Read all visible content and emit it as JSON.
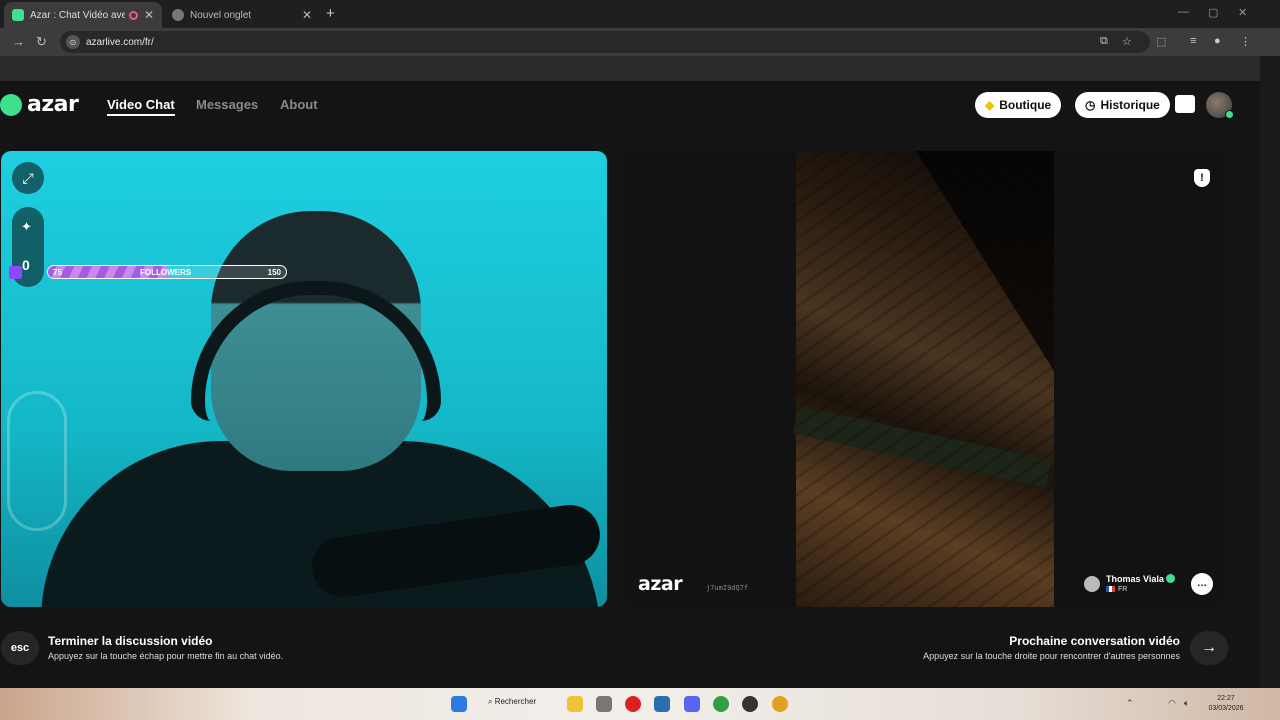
{
  "browser": {
    "tabs": [
      {
        "title": "Azar : Chat Vidéo avec de n",
        "active": true
      },
      {
        "title": "Nouvel onglet",
        "active": false
      }
    ],
    "url": "azarlive.com/fr/"
  },
  "header": {
    "logo": "azar",
    "nav": [
      "Video Chat",
      "Messages",
      "About"
    ],
    "boutique_label": "Boutique",
    "historique_label": "Historique"
  },
  "local_video": {
    "followers": {
      "start": "75",
      "label": "FOLLOWERS",
      "goal": "150",
      "progress": 0.5
    },
    "counter": "0"
  },
  "remote_video": {
    "watermark_logo": "azar",
    "watermark_id": "j7umI9dQ7f",
    "peer_name": "Thomas Viala",
    "peer_country": "FR"
  },
  "footer": {
    "esc_label": "esc",
    "end_title": "Terminer la discussion vidéo",
    "end_sub": "Appuyez sur la touche échap pour mettre fin au chat vidéo.",
    "next_title": "Prochaine conversation vidéo",
    "next_sub": "Appuyez sur la touche droite pour rencontrer d'autres personnes"
  },
  "taskbar": {
    "search_label": "Rechercher",
    "time": "22:27",
    "date": "03/03/2026"
  },
  "colors": {
    "accent": "#3ee08c",
    "twitch": "#9146ff",
    "follow_bar": "#a45de0"
  }
}
